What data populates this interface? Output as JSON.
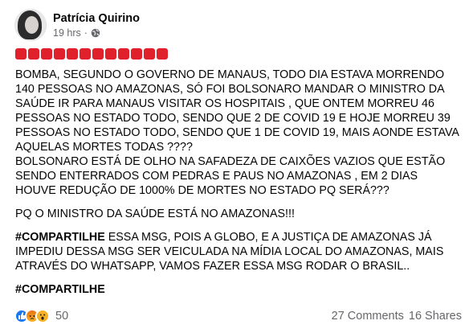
{
  "post": {
    "author": "Patrícia Quirino",
    "time": "19 hrs",
    "separator": "·",
    "audience_icon": "globe-icon",
    "emoji_prefix": {
      "icon": "red-square-icon",
      "count": 12,
      "color": "#e0212b"
    },
    "lines": [
      "BOMBA, SEGUNDO O GOVERNO DE MANAUS, TODO DIA ESTAVA MORRENDO",
      "140 PESSOAS NO AMAZONAS, SÓ FOI BOLSONARO MANDAR O MINISTRO DA",
      "SAÚDE IR PARA MANAUS VISITAR OS HOSPITAIS , QUE ONTEM MORREU 46",
      "PESSOAS NO ESTADO TODO, SENDO QUE 2 DE COVID 19 E HOJE MORREU 39",
      "PESSOAS NO ESTADO TODO, SENDO QUE 1 DE COVID 19, MAIS AONDE ESTAVA",
      "AQUELAS MORTES TODAS ????",
      "BOLSONARO ESTÁ DE OLHO NA SAFADEZA DE CAIXÕES VAZIOS QUE ESTÃO",
      "SENDO ENTERRADOS COM PEDRAS E PAUS NO AMAZONAS , EM 2 DIAS",
      "HOUVE REDUÇÃO DE 1000% DE MORTES NO ESTADO PQ SERÁ???"
    ],
    "minister_line": "PQ O MINISTRO DA SAÚDE ESTÁ NO AMAZONAS!!!",
    "share_hashtag": "#COMPARTILHE",
    "share_lines": [
      " ESSA MSG, POIS A GLOBO, E A JUSTIÇA DE AMAZONAS JÁ",
      "IMPEDIU DESSA MSG SER VEICULADA NA MÍDIA LOCAL DO AMAZONAS, MAIS",
      "ATRAVÉS DO WHATSAPP, VAMOS FAZER ESSA MSG RODAR O BRASIL.."
    ],
    "final_hashtag": "#COMPARTILHE"
  },
  "footer": {
    "reaction_icons": [
      "like-icon",
      "angry-icon",
      "wow-icon"
    ],
    "reaction_count": "50",
    "comments": "27 Comments",
    "shares": "16 Shares"
  }
}
